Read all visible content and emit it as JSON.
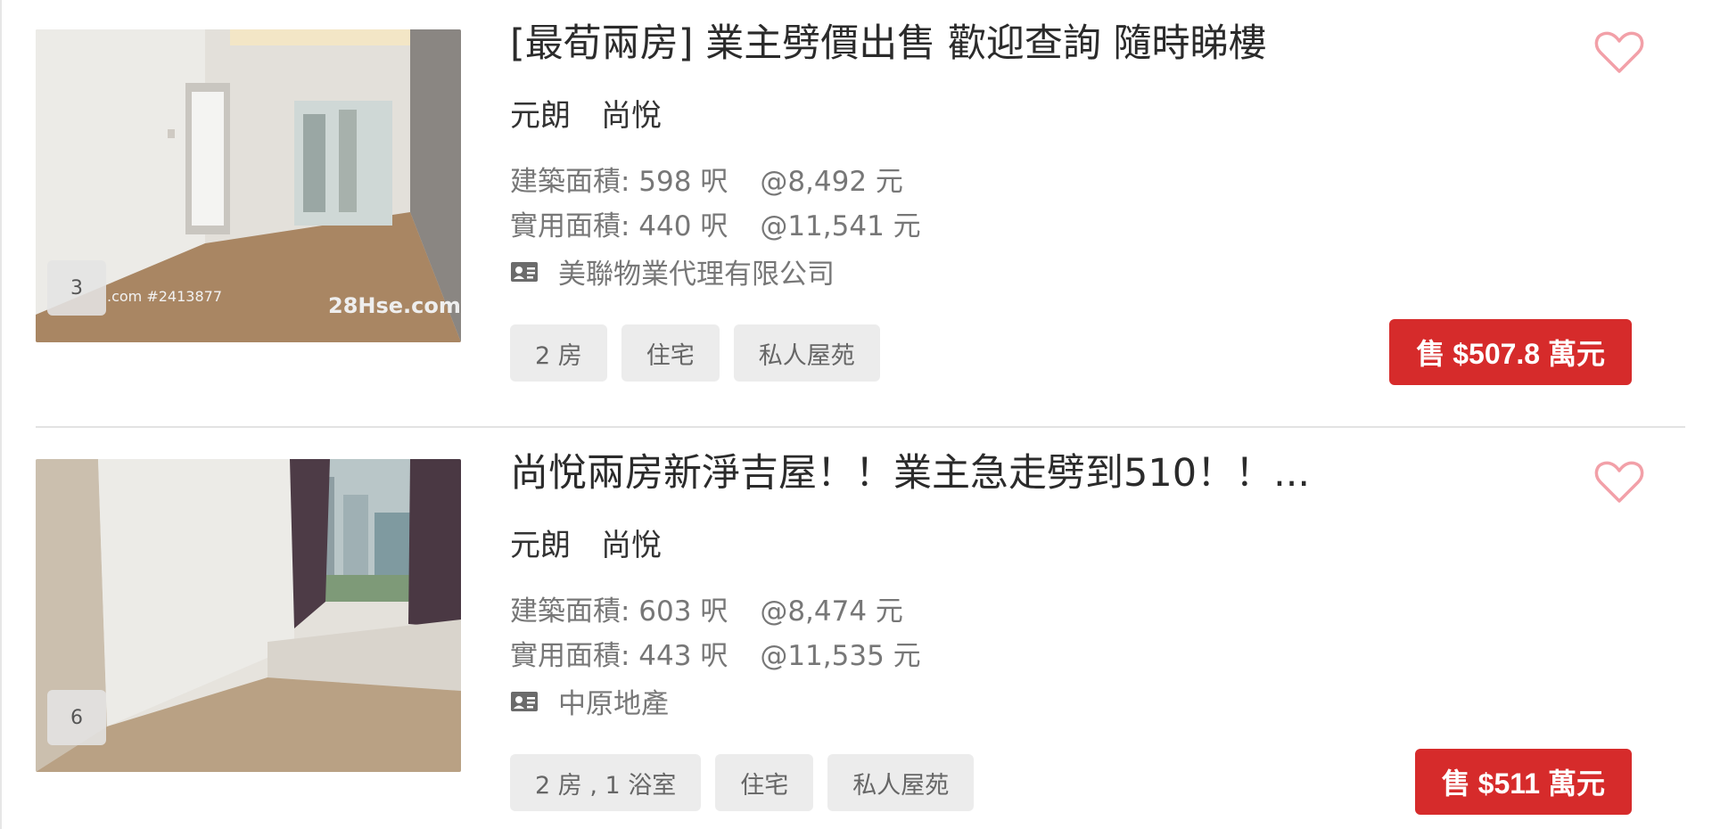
{
  "colors": {
    "accent": "#d62b2b",
    "heart": "#f2a0a8",
    "tag_bg": "#ececec"
  },
  "listings": [
    {
      "title": "[最荀兩房] 業主劈價出售 歡迎查詢 隨時睇樓",
      "district": "元朗",
      "estate": "尚悅",
      "gross_area": "建築面積: 598 呎",
      "gross_price_per": "@8,492 元",
      "saleable_area": "實用面積: 440 呎",
      "saleable_price_per": "@11,541 元",
      "agency_icon": "id-card-icon",
      "agency": "美聯物業代理有限公司",
      "photo_count": "3",
      "watermark_left": ".com #2413877",
      "watermark_right": "28Hse.com",
      "tags": [
        "2 房",
        "住宅",
        "私人屋苑"
      ],
      "price_label": "售 $507.8 萬元"
    },
    {
      "title": "尚悅兩房新淨吉屋！！業主急走劈到510！！...",
      "district": "元朗",
      "estate": "尚悅",
      "gross_area": "建築面積: 603 呎",
      "gross_price_per": "@8,474 元",
      "saleable_area": "實用面積: 443 呎",
      "saleable_price_per": "@11,535 元",
      "agency_icon": "id-card-icon",
      "agency": "中原地產",
      "photo_count": "6",
      "tags": [
        "2 房 , 1 浴室",
        "住宅",
        "私人屋苑"
      ],
      "price_label": "售 $511 萬元"
    }
  ]
}
